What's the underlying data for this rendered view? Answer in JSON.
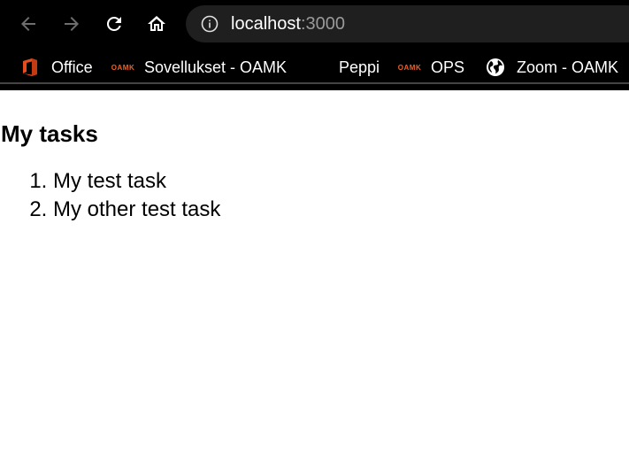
{
  "browser": {
    "url_host": "localhost",
    "url_port": ":3000",
    "bookmarks": [
      {
        "label": "Office",
        "icon": "office-icon"
      },
      {
        "label": "Sovellukset - OAMK",
        "icon": "oamk-icon"
      },
      {
        "label": "Peppi",
        "icon": ""
      },
      {
        "label": "OPS",
        "icon": "oamk-icon"
      },
      {
        "label": "Zoom - OAMK",
        "icon": "globe-icon"
      }
    ],
    "oamk_logo_text": "OAMK"
  },
  "page": {
    "title": "My tasks",
    "tasks": [
      "My test task",
      "My other test task"
    ]
  }
}
